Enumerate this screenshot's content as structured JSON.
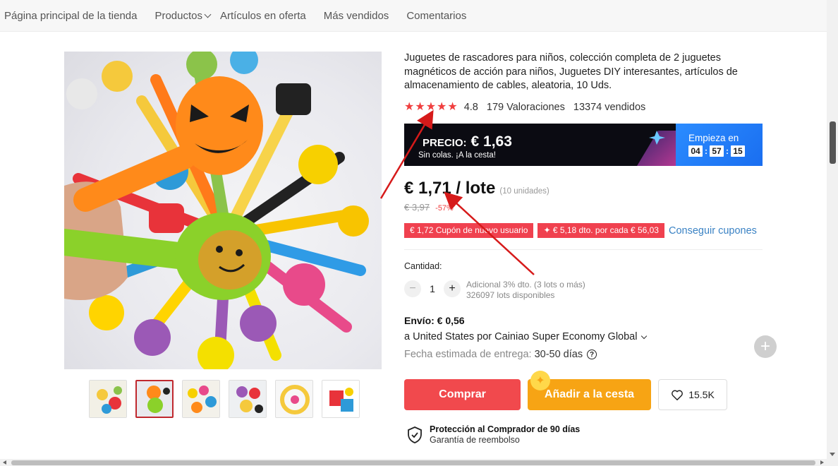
{
  "store_nav": {
    "items": [
      {
        "label": "Página principal de la tienda"
      },
      {
        "label": "Productos"
      },
      {
        "label": "Artículos en oferta"
      },
      {
        "label": "Más vendidos"
      },
      {
        "label": "Comentarios"
      }
    ]
  },
  "product": {
    "title": "Juguetes de rascadores para niños, colección completa de 2 juguetes magnéticos de acción para niños, Juguetes DIY interesantes, artículos de almacenamiento de cables, aleatoria, 10 Uds.",
    "rating": "4.8",
    "reviews": "179 Valoraciones",
    "sold": "13374 vendidos",
    "stars_filled": 5
  },
  "promo": {
    "label": "PRECIO:",
    "price": "€ 1,63",
    "subtitle": "Sin colas. ¡A la cesta!",
    "starts_label": "Empieza en",
    "countdown": {
      "h": "04",
      "m": "57",
      "s": "15"
    },
    "colon": ":"
  },
  "price": {
    "current": "€ 1,71 / lote",
    "units": "(10 unidades)",
    "original": "€ 3,97",
    "discount": "-57%"
  },
  "coupons": {
    "items": [
      "€ 1,72 Cupón de nuevo usuario",
      "✦ € 5,18 dto. por cada € 56,03"
    ],
    "link": "Conseguir cupones"
  },
  "quantity": {
    "label": "Cantidad:",
    "value": "1",
    "minus": "−",
    "plus": "+",
    "extra_discount": "Adicional 3% dto. (3 lots o más)",
    "available": "326097 lots disponibles"
  },
  "shipping": {
    "title": "Envío: € 0,56",
    "destination": "a United States por Cainiao Super Economy Global",
    "delivery_label": "Fecha estimada de entrega:",
    "delivery_days": "30-50 días",
    "help": "?"
  },
  "actions": {
    "buy": "Comprar",
    "add_to_cart": "Añadir a la cesta",
    "wishlist_count": "15.5K",
    "fab_plus": "+"
  },
  "protection": {
    "title": "Protección al Comprador de 90 días",
    "subtitle": "Garantía de reembolso"
  },
  "colors": {
    "buy": "#f1494d",
    "cart": "#f7a414",
    "star": "#f03e3e",
    "coupon": "#f0414f",
    "link": "#3a82c4",
    "annotation_arrow": "#d61a1a"
  }
}
